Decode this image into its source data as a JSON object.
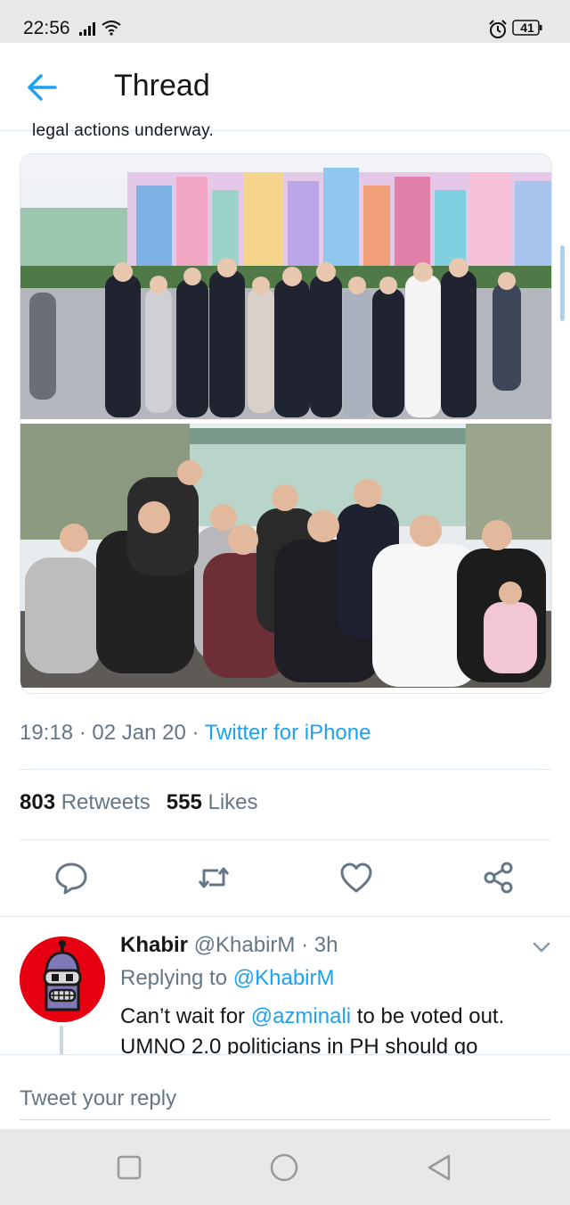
{
  "status_bar": {
    "time": "22:56",
    "battery": "41",
    "icons": [
      "signal-icon",
      "wifi-icon",
      "alarm-icon",
      "battery-icon"
    ]
  },
  "header": {
    "back_icon": "back-arrow-icon",
    "title": "Thread"
  },
  "tweet": {
    "cut_text": "legal actions underway.",
    "time": "19:18",
    "date": "02 Jan 20",
    "source": "Twitter for iPhone",
    "separator": " · ",
    "retweets_count": "803",
    "retweets_label": "Retweets",
    "likes_count": "555",
    "likes_label": "Likes",
    "actions": [
      "reply-icon",
      "retweet-icon",
      "like-icon",
      "share-icon"
    ]
  },
  "reply": {
    "name": "Khabir",
    "handle": "@KhabirM",
    "time": "3h",
    "replying_prefix": "Replying to ",
    "replying_to": "@KhabirM",
    "text_before": "Can’t wait for ",
    "mention": "@azminali",
    "text_after": " to be voted out. UMNO 2.0 politicians in PH should go"
  },
  "compose": {
    "placeholder": "Tweet your reply"
  },
  "colors": {
    "accent": "#1da1f2",
    "muted": "#657786",
    "text": "#14171a",
    "avatar_bg": "#e60012"
  }
}
